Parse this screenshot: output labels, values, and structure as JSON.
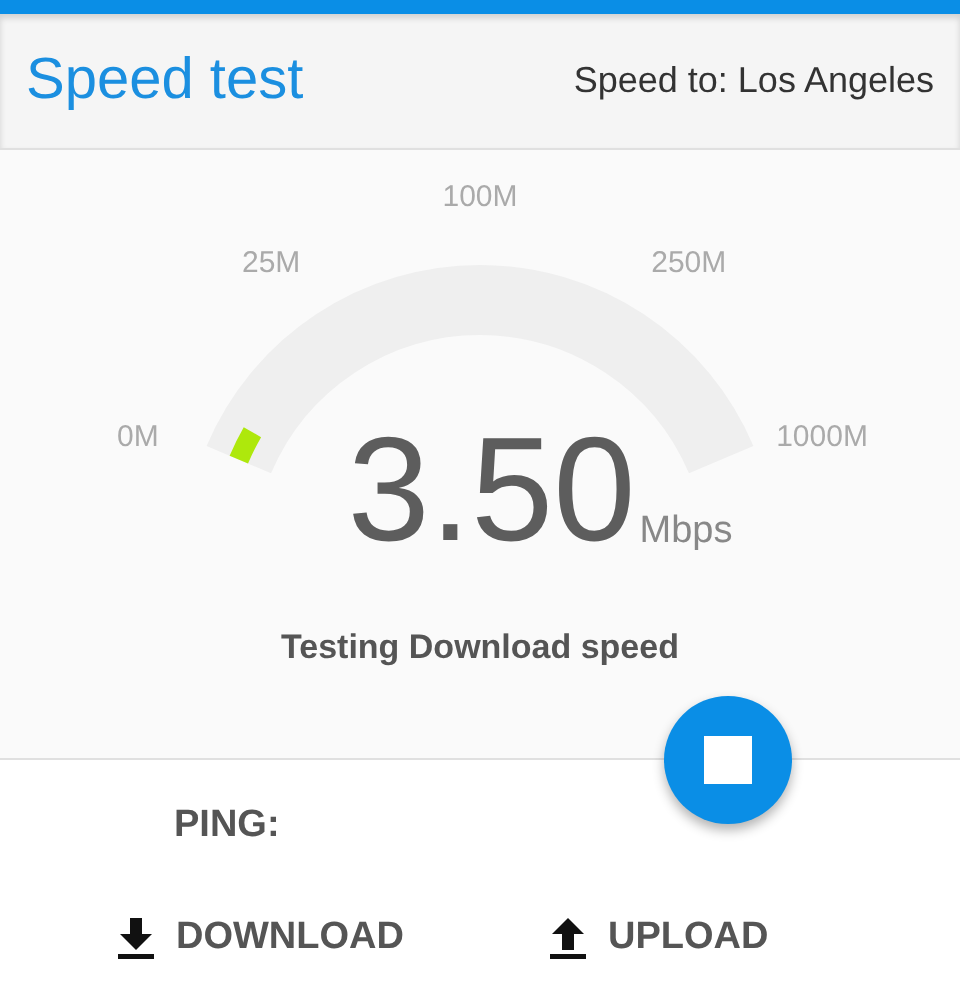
{
  "header": {
    "title": "Speed test",
    "destination": "Speed to: Los Angeles"
  },
  "gauge": {
    "ticks": [
      "0M",
      "25M",
      "100M",
      "250M",
      "1000M"
    ],
    "value": "3.50",
    "unit": "Mbps",
    "status": "Testing Download speed"
  },
  "ping": {
    "label": "PING:"
  },
  "results": [
    {
      "kind": "download",
      "label": "DOWNLOAD"
    },
    {
      "kind": "upload",
      "label": "UPLOAD"
    }
  ]
}
